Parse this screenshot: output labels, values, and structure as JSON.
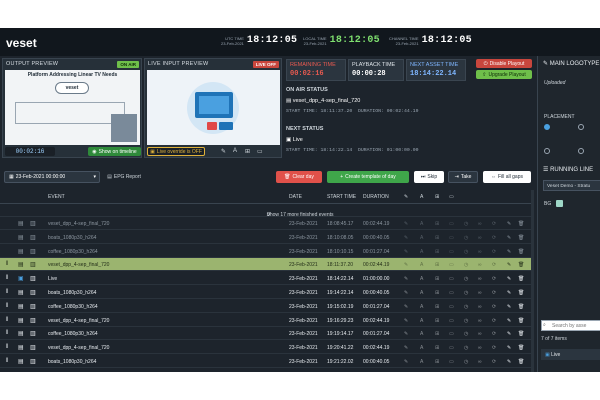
{
  "app": {
    "logo": "veset"
  },
  "clocks": [
    {
      "label": "UTC TIME",
      "date": "23-Feb-2021",
      "time": "18:12:05",
      "green": false
    },
    {
      "label": "LOCAL TIME",
      "date": "23-Feb-2021",
      "time": "18:12:05",
      "green": true
    },
    {
      "label": "CHANNEL TIME",
      "date": "23-Feb-2021",
      "time": "18:12:05",
      "green": false
    }
  ],
  "output": {
    "title": "OUTPUT PREVIEW",
    "badge": "ON AIR",
    "timecode": "00:02:16",
    "show_btn": "Show on timeline",
    "thumb_title": "Platform Addressing Linear TV Needs",
    "thumb_brand": "veset"
  },
  "input": {
    "title": "LIVE INPUT PREVIEW",
    "badge": "LIVE OFF",
    "override": "Live override is OFF"
  },
  "status": {
    "remaining": {
      "label": "REMAINING TIME",
      "value": "00:02:16"
    },
    "playback": {
      "label": "PLAYBACK TIME",
      "value": "00:00:28"
    },
    "next": {
      "label": "NEXT ASSET TIME",
      "value": "18:14:22.14"
    },
    "disable_btn": "Disable Playout",
    "upgrade_btn": "Upgrade Playout",
    "on_air_title": "ON AIR STATUS",
    "on_air_name": "veset_dpp_4-sep_final_720",
    "on_air_start": "START TIME: 18:11:37.20",
    "on_air_dur": "DURATION: 00:02:44.19",
    "next_title": "NEXT STATUS",
    "next_name": "Live",
    "next_start": "START TIME: 18:14:22.14",
    "next_dur": "DURATION: 01:00:00.00"
  },
  "toolbar": {
    "date": "23-Feb-2021 00:00:00",
    "epg": "EPG Report",
    "clear": "Clear day",
    "template": "Create template of day",
    "skip": "Skip",
    "take": "Take",
    "fill": "Fill all gaps"
  },
  "table": {
    "headers": {
      "event": "EVENT",
      "date": "DATE",
      "start": "START TIME",
      "duration": "DURATION"
    },
    "show_more": "Show 17 more finished events",
    "rows": [
      {
        "event": "veset_dpp_4-sep_final_720",
        "date": "23-Feb-2021",
        "start": "18:08:45.17",
        "dur": "00:02:44.19",
        "state": "fin",
        "type": "file"
      },
      {
        "event": "boats_1080p30_h264",
        "date": "23-Feb-2021",
        "start": "18:10:08.05",
        "dur": "00:00:40.05",
        "state": "fin",
        "type": "file"
      },
      {
        "event": "coffee_1080p30_h264",
        "date": "23-Feb-2021",
        "start": "18:10:10.15",
        "dur": "00:01:27.04",
        "state": "fin",
        "type": "file"
      },
      {
        "event": "veset_dpp_4-sep_final_720",
        "date": "23-Feb-2021",
        "start": "18:11:37.20",
        "dur": "00:02:44.19",
        "state": "cur",
        "type": "file"
      },
      {
        "event": "Live",
        "date": "23-Feb-2021",
        "start": "18:14:22.14",
        "dur": "01:00:00.00",
        "state": "up",
        "type": "live"
      },
      {
        "event": "boats_1080p30_h264",
        "date": "23-Feb-2021",
        "start": "19:14:22.14",
        "dur": "00:00:40.05",
        "state": "up",
        "type": "file"
      },
      {
        "event": "coffee_1080p30_h264",
        "date": "23-Feb-2021",
        "start": "19:15:02.19",
        "dur": "00:01:27.04",
        "state": "up",
        "type": "file"
      },
      {
        "event": "veset_dpp_4-sep_final_720",
        "date": "23-Feb-2021",
        "start": "19:16:29.23",
        "dur": "00:02:44.19",
        "state": "up",
        "type": "file"
      },
      {
        "event": "coffee_1080p30_h264",
        "date": "23-Feb-2021",
        "start": "19:19:14.17",
        "dur": "00:01:27.04",
        "state": "up",
        "type": "file"
      },
      {
        "event": "veset_dpp_4-sep_final_720",
        "date": "23-Feb-2021",
        "start": "19:20:41.22",
        "dur": "00:02:44.19",
        "state": "up",
        "type": "file"
      },
      {
        "event": "boats_1080p30_h264",
        "date": "23-Feb-2021",
        "start": "19:21:22.02",
        "dur": "00:00:40.05",
        "state": "up",
        "type": "file"
      }
    ]
  },
  "right": {
    "logo_title": "MAIN LOGOTYPE",
    "uploaded": "Uploaded",
    "placement": "PLACEMENT",
    "running_title": "RUNNING LINE",
    "select": "Veset Demo - Stratu",
    "bg": "BG",
    "search_ph": "Search by asse",
    "count": "7 of 7 items",
    "live_item": "Live"
  }
}
